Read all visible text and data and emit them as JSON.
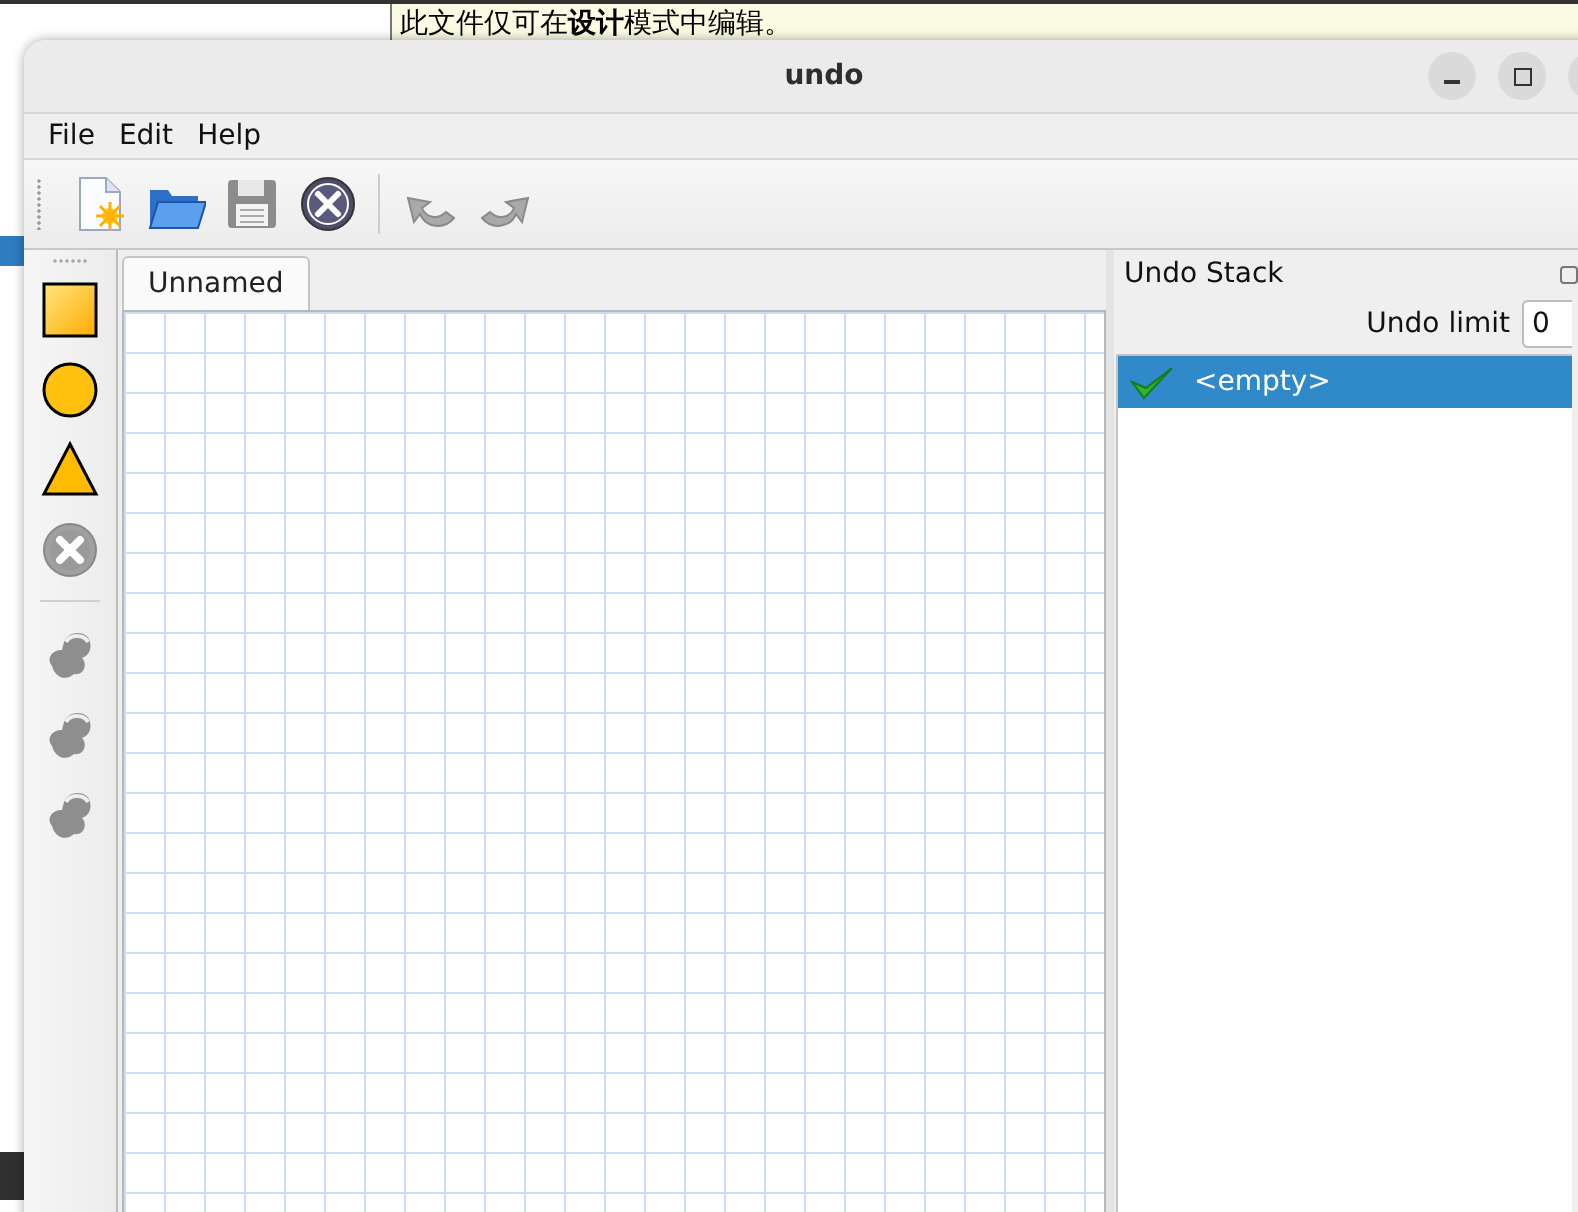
{
  "desktop": {
    "notice": "此文件仅可在**设计**模式中编辑。"
  },
  "window": {
    "title": "undo"
  },
  "menu": [
    {
      "label": "File"
    },
    {
      "label": "Edit"
    },
    {
      "label": "Help"
    }
  ],
  "toolbar": [
    [
      {
        "kind": "new",
        "disabled": false
      },
      {
        "kind": "open",
        "disabled": false
      },
      {
        "kind": "save",
        "disabled": false
      },
      {
        "kind": "delete",
        "disabled": false
      }
    ],
    [
      {
        "kind": "undo",
        "disabled": true
      },
      {
        "kind": "redo",
        "disabled": true
      }
    ]
  ],
  "shape_tools": [
    [
      {
        "kind": "rectangle",
        "disabled": false
      },
      {
        "kind": "circle",
        "disabled": false
      },
      {
        "kind": "triangle",
        "disabled": false
      },
      {
        "kind": "delete",
        "disabled": true
      }
    ],
    [
      {
        "kind": "node",
        "disabled": true
      },
      {
        "kind": "node",
        "disabled": true
      },
      {
        "kind": "node",
        "disabled": true
      }
    ]
  ],
  "tabs": [
    {
      "label": "Unnamed",
      "selected": true
    }
  ],
  "undo_stack": {
    "title": "Undo Stack",
    "limit_label": "Undo limit",
    "limit_value": "0",
    "items": [
      {
        "label": "<empty>",
        "selected": true
      }
    ]
  }
}
